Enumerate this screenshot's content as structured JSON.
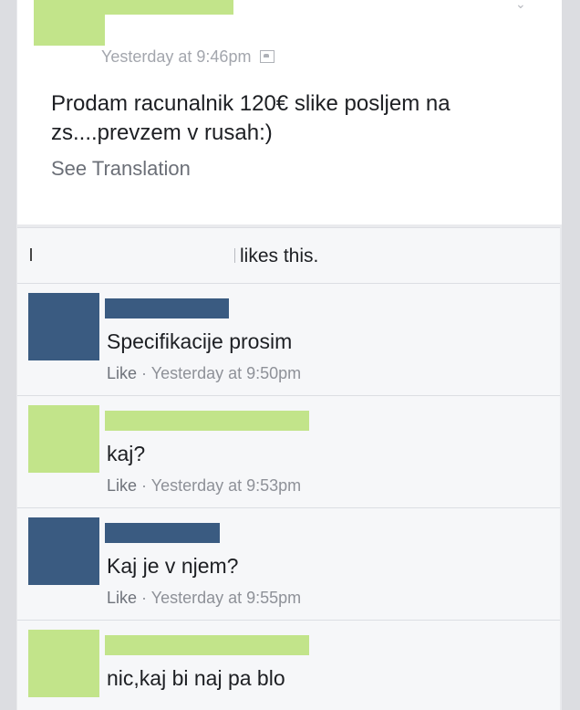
{
  "post": {
    "timestamp": "Yesterday at 9:46pm",
    "text": "Prodam racunalnik 120€ slike posljem na zs....prevzem v rusah:)",
    "see_translation": "See Translation"
  },
  "likes": {
    "text": "likes this."
  },
  "comments": [
    {
      "text": "Specifikacije prosim",
      "like": "Like",
      "time": "· Yesterday at 9:50pm",
      "avatar_color": "#3a5b81"
    },
    {
      "text": "kaj?",
      "like": "Like",
      "time": "· Yesterday at 9:53pm",
      "avatar_color": "#c2e48a"
    },
    {
      "text": "Kaj je v njem?",
      "like": "Like",
      "time": "· Yesterday at 9:55pm",
      "avatar_color": "#3a5b81"
    },
    {
      "text": "nic,kaj bi naj pa blo",
      "like": "",
      "time": "",
      "avatar_color": "#c2e48a"
    }
  ],
  "colors": {
    "redact_blue": "#3a5b81",
    "redact_green": "#c2e48a"
  }
}
